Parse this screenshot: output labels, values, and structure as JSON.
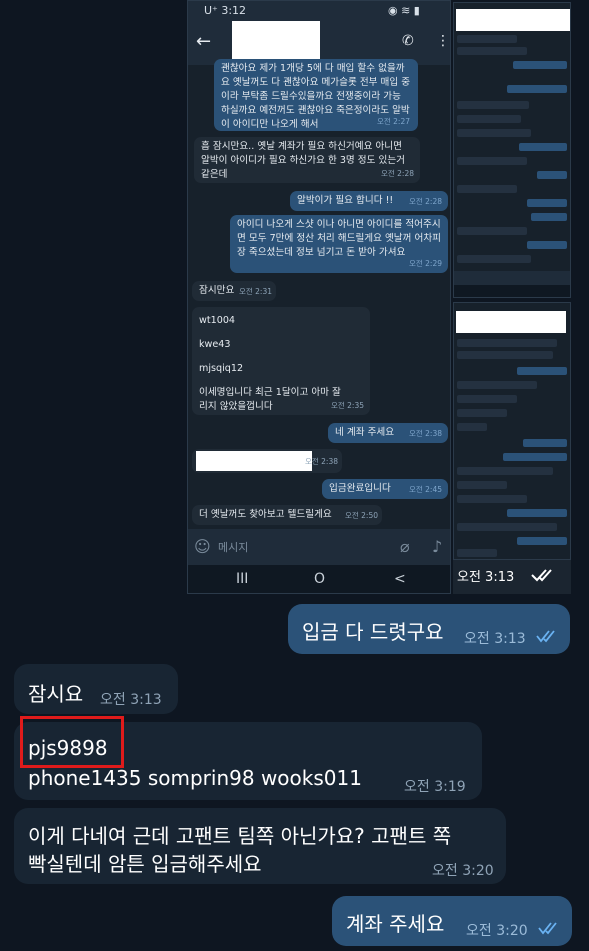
{
  "embedded_chat": {
    "status_time": "U⁺ 3:12",
    "messages": [
      {
        "text": "괜찮아요  제가 1개당 5에 다 매입 할수 없을까요 옛날꺼도 다 괜찮아요  메가슬롯 전부 매입 중이라 부탁좀 드릴수있을까요 전쟁중이라 가능 하실까요 예전꺼도 괜찮아요 죽은정이라도 알박이 아이디만 나오게 해서",
        "time": "오전 2:27"
      },
      {
        "text": "흠 잠시만요.. 옛날 계좌가 필요 하신거예요  아니면 알박이 아이디가 필요 하신가요  한 3명 정도 있는거 같은데",
        "time": "오전 2:28"
      },
      {
        "text": "알박이가 필요 합니다 !!",
        "time": "오전 2:28"
      },
      {
        "text": "아이디 나오게 스샷 이나 아니면 아이디를 적어주시면  모두 7만에 정산 처리 해드릴게요 옛날꺼 어차피 장 죽으셨는데 정보 넘기고 돈 받아 가셔요",
        "time": "오전 2:29"
      },
      {
        "text": "잠시만요",
        "time": "오전 2:31"
      },
      {
        "ids": [
          "wt1004",
          "kwe43",
          "mjsqiq12"
        ],
        "text": "이세명입니다 최근 1달이고 아마 잘리지 않았을껍니다",
        "time": "오전 2:35"
      },
      {
        "text": "네 계좌 주세요",
        "time": "오전 2:38"
      },
      {
        "text": "",
        "time": "오전 2:38"
      },
      {
        "text": "입금완료입니다",
        "time": "오전 2:45"
      },
      {
        "text": "더 옛날꺼도 찾아보고  텔드릴게요",
        "time": "오전 2:50"
      }
    ],
    "composer_placeholder": "메시지",
    "nav": [
      "III",
      "O",
      "<"
    ],
    "thumb_time": "오전 3:13"
  },
  "chat": [
    {
      "text": "입금 다 드렷구요",
      "time": "오전 3:13",
      "outgoing": true
    },
    {
      "text": "잠시요",
      "time": "오전 3:13",
      "outgoing": false
    },
    {
      "highlight": "pjs9898",
      "text": "phone1435    somprin98   wooks011",
      "time": "오전 3:19",
      "outgoing": false
    },
    {
      "line1": "이게 다네여  근데 고팬트 팀쪽 아닌가요?  고팬트 쪽",
      "line2": "빡실텐데  암튼 입금해주세요",
      "time": "오전 3:20",
      "outgoing": false
    },
    {
      "text": "계좌 주세요",
      "time": "오전 3:20",
      "outgoing": true
    }
  ],
  "colors": {
    "background": "#0e1621",
    "incoming": "#182533",
    "outgoing": "#2b5278",
    "highlight": "#e01b1b"
  }
}
